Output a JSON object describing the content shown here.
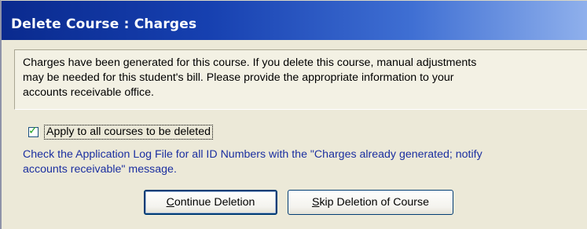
{
  "dialog": {
    "title": "Delete Course : Charges"
  },
  "message": {
    "text": "Charges have been generated for this course.  If you delete this course, manual adjustments\nmay be needed for this student's bill.  Please provide the appropriate information to your\naccounts receivable office."
  },
  "apply_all": {
    "label": "Apply to all courses to be deleted",
    "checked": true
  },
  "info": {
    "text": "Check the Application Log File for all ID Numbers with the \"Charges already generated; notify\naccounts receivable\" message."
  },
  "buttons": {
    "continue": {
      "mnemonic": "C",
      "rest": "ontinue Deletion"
    },
    "skip": {
      "mnemonic": "S",
      "rest": "kip Deletion of Course"
    }
  },
  "colors": {
    "title_bar_start": "#0a2a8e",
    "title_bar_end": "#8fb0ec",
    "dialog_background": "#ece9d8",
    "info_text": "#1b2fa0",
    "check_mark": "#21a121"
  }
}
